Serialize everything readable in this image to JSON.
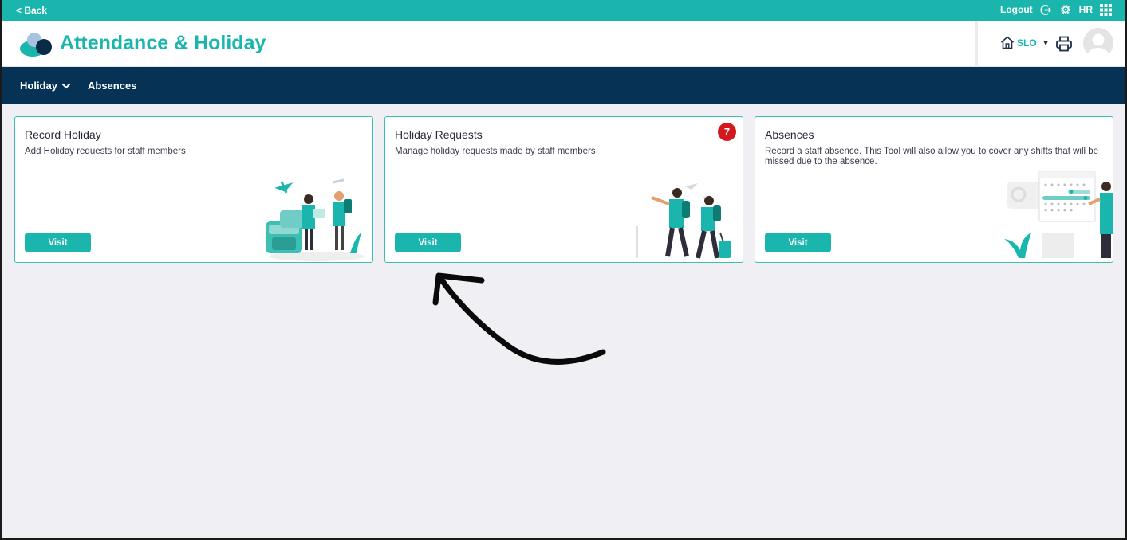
{
  "topbar": {
    "back_label": "< Back",
    "logout_label": "Logout",
    "module_label": "HR"
  },
  "header": {
    "app_title": "Attendance & Holiday",
    "site_label": "SLO"
  },
  "nav": {
    "items": [
      {
        "label": "Holiday",
        "has_dropdown": true
      },
      {
        "label": "Absences",
        "has_dropdown": false
      }
    ]
  },
  "cards": [
    {
      "title": "Record Holiday",
      "description": "Add Holiday requests for staff members",
      "button_label": "Visit",
      "illustration": "travelers-luggage-illustration"
    },
    {
      "title": "Holiday Requests",
      "description": "Manage holiday requests made by staff members",
      "button_label": "Visit",
      "badge_count": "7",
      "illustration": "travelers-walking-illustration"
    },
    {
      "title": "Absences",
      "description": "Record a staff absence. This Tool will also allow you to cover any shifts that will be missed due to the absence.",
      "button_label": "Visit",
      "illustration": "calendar-person-illustration"
    }
  ],
  "colors": {
    "brand_teal": "#1ab5ad",
    "nav_navy": "#063355",
    "badge_red": "#d3181e",
    "page_background": "#f0f0f4"
  }
}
